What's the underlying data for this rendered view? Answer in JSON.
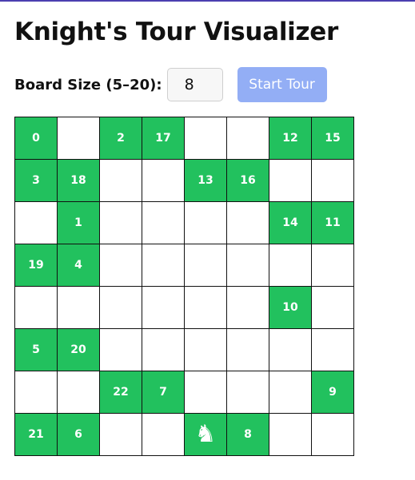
{
  "page": {
    "title": "Knight's Tour Visualizer"
  },
  "controls": {
    "size_label": "Board Size (5–20):",
    "size_value": "8",
    "start_button_label": "Start Tour"
  },
  "colors": {
    "visited": "#22c15e",
    "empty": "#ffffff",
    "grid_line": "#111111",
    "button": "#93aef5"
  },
  "board": {
    "size": 8,
    "knight_icon": "knight-icon",
    "rows": [
      [
        "0",
        "",
        "2",
        "17",
        "",
        "",
        "12",
        "15"
      ],
      [
        "3",
        "18",
        "",
        "",
        "13",
        "16",
        "",
        ""
      ],
      [
        "",
        "1",
        "",
        "",
        "",
        "",
        "14",
        "11"
      ],
      [
        "19",
        "4",
        "",
        "",
        "",
        "",
        "",
        ""
      ],
      [
        "",
        "",
        "",
        "",
        "",
        "",
        "10",
        ""
      ],
      [
        "5",
        "20",
        "",
        "",
        "",
        "",
        "",
        ""
      ],
      [
        "",
        "",
        "22",
        "7",
        "",
        "",
        "",
        "9"
      ],
      [
        "21",
        "6",
        "",
        "",
        "K",
        "8",
        "",
        ""
      ]
    ]
  }
}
